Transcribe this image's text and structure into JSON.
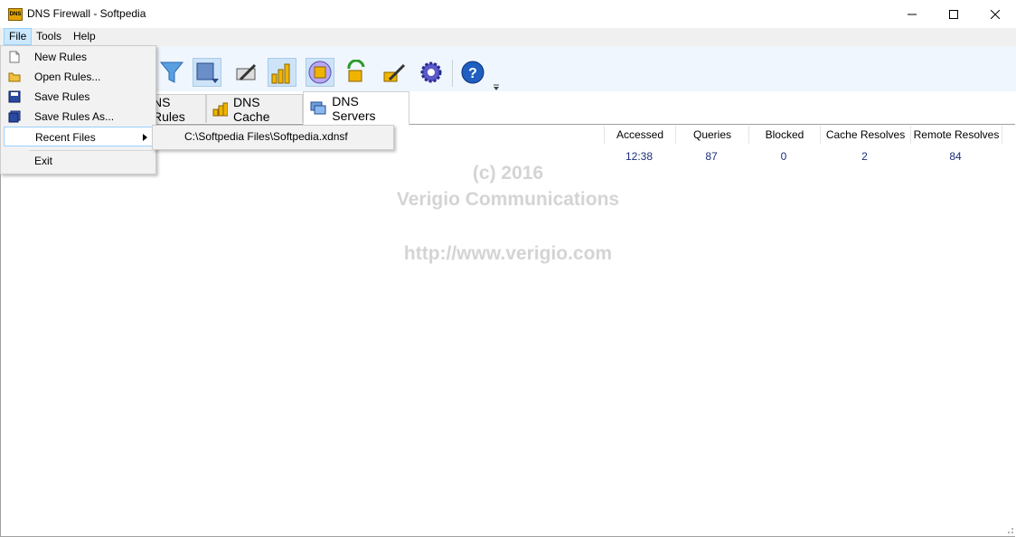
{
  "window": {
    "title": "DNS Firewall - Softpedia",
    "app_icon_text": "DNS",
    "minimize_icon": "minimize-icon",
    "maximize_icon": "maximize-icon",
    "close_icon": "close-icon"
  },
  "menubar": {
    "items": [
      "File",
      "Tools",
      "Help"
    ]
  },
  "file_menu": {
    "items": [
      {
        "label": "New Rules",
        "icon": "new-document-icon"
      },
      {
        "label": "Open Rules...",
        "icon": "open-folder-icon"
      },
      {
        "label": "Save Rules",
        "icon": "save-disk-icon"
      },
      {
        "label": "Save Rules As...",
        "icon": "save-as-icon"
      },
      {
        "label": "Recent Files",
        "icon": "submenu-arrow-icon"
      },
      {
        "label": "Exit",
        "icon": ""
      }
    ],
    "recent_files": [
      "C:\\Softpedia Files\\Softpedia.xdnsf"
    ]
  },
  "toolbar": {
    "icons": [
      "filter-icon",
      "dropdown-view-icon",
      "edit-icon",
      "chart-icon",
      "coins-icon",
      "refresh-coins-icon",
      "clear-icon",
      "settings-icon",
      "help-icon",
      "overflow-icon"
    ]
  },
  "tabs": [
    {
      "label": "DNS Rules",
      "visible_label": "NS Rules",
      "icon": "rules-icon"
    },
    {
      "label": "DNS Cache",
      "icon": "cache-coins-icon"
    },
    {
      "label": "DNS Servers",
      "icon": "servers-icon",
      "active": true
    }
  ],
  "table": {
    "columns": [
      "Accessed",
      "Queries",
      "Blocked",
      "Cache Resolves",
      "Remote Resolves"
    ],
    "rows": [
      {
        "accessed": "12:38",
        "queries": "87",
        "blocked": "0",
        "cache_resolves": "2",
        "remote_resolves": "84"
      }
    ]
  },
  "watermark": {
    "line1": "(c) 2016",
    "line2": "Verigio Communications",
    "line3": "http://www.verigio.com"
  },
  "colors": {
    "menu_highlight": "#cce8ff",
    "toolbar_bg": "#f0f6fd",
    "cell_text": "#1a2f7a"
  }
}
